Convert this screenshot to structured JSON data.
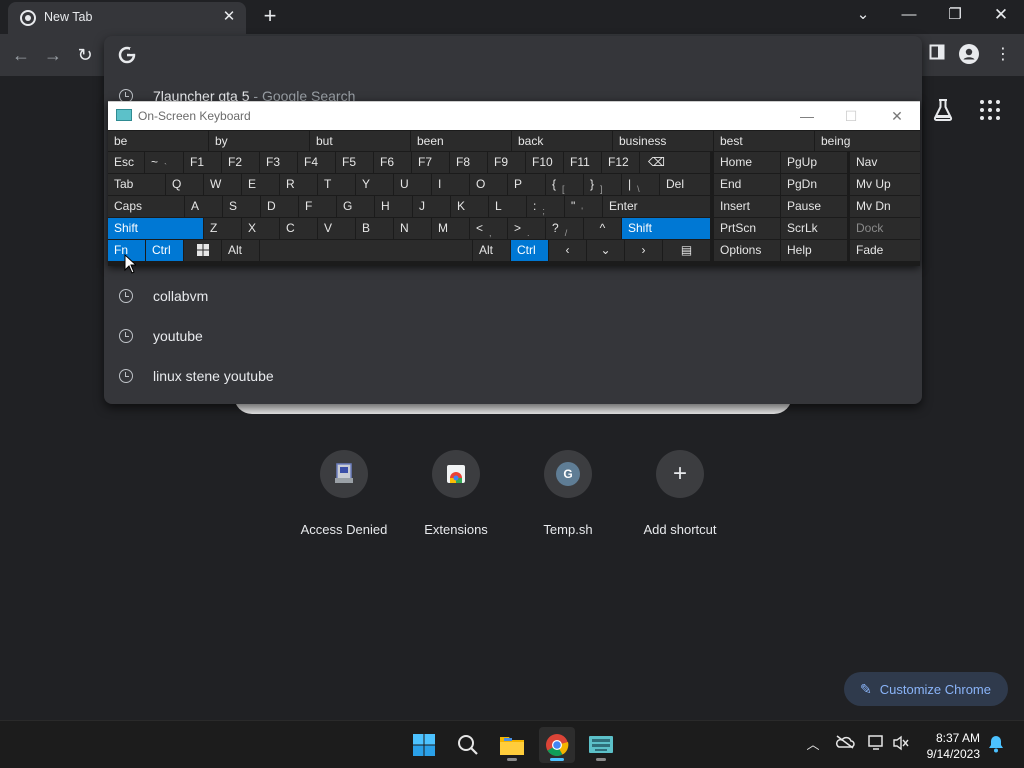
{
  "tab": {
    "title": "New Tab"
  },
  "omnibox": {
    "suggestions": [
      {
        "text": "7launcher gta 5",
        "sub": " - Google Search"
      },
      {
        "text": "collabvm",
        "sub": ""
      },
      {
        "text": "youtube",
        "sub": ""
      },
      {
        "text": "linux stene youtube",
        "sub": ""
      }
    ]
  },
  "shortcuts": [
    {
      "label": "Access Denied",
      "icon": "access-denied-icon"
    },
    {
      "label": "Extensions",
      "icon": "extensions-icon"
    },
    {
      "label": "Temp.sh",
      "icon": "temp-sh-icon",
      "letter": "G"
    },
    {
      "label": "Add shortcut",
      "icon": "plus-icon"
    }
  ],
  "customize_label": "Customize Chrome",
  "osk": {
    "title": "On-Screen Keyboard",
    "predictions": [
      "be",
      "by",
      "but",
      "been",
      "back",
      "business",
      "best",
      "being"
    ],
    "row1": [
      "Esc",
      "~",
      "F1",
      "F2",
      "F3",
      "F4",
      "F5",
      "F6",
      "F7",
      "F8",
      "F9",
      "F10",
      "F11",
      "F12",
      "⌫"
    ],
    "row1_sub": "`",
    "row2": [
      "Tab",
      "Q",
      "W",
      "E",
      "R",
      "T",
      "Y",
      "U",
      "I",
      "O",
      "P",
      "{",
      "}",
      "|",
      "Del"
    ],
    "row2_sub": [
      "[",
      "]",
      "\\"
    ],
    "row3": [
      "Caps",
      "A",
      "S",
      "D",
      "F",
      "G",
      "H",
      "J",
      "K",
      "L",
      ":",
      "\"",
      "Enter"
    ],
    "row3_sub": [
      ";",
      "'"
    ],
    "row4": [
      "Shift",
      "Z",
      "X",
      "C",
      "V",
      "B",
      "N",
      "M",
      "<",
      ">",
      "?",
      "^",
      "Shift"
    ],
    "row4_sub": [
      ",",
      ".",
      "/"
    ],
    "row5": [
      "Fn",
      "Ctrl",
      "Alt",
      "Alt",
      "Ctrl"
    ],
    "nav_col1": [
      "Home",
      "End",
      "Insert",
      "PrtScn",
      "Options"
    ],
    "nav_col2": [
      "PgUp",
      "PgDn",
      "Pause",
      "ScrLk",
      "Help"
    ],
    "nav_col3": [
      "Nav",
      "Mv Up",
      "Mv Dn",
      "Dock",
      "Fade"
    ]
  },
  "clock": {
    "time": "8:37 AM",
    "date": "9/14/2023"
  }
}
